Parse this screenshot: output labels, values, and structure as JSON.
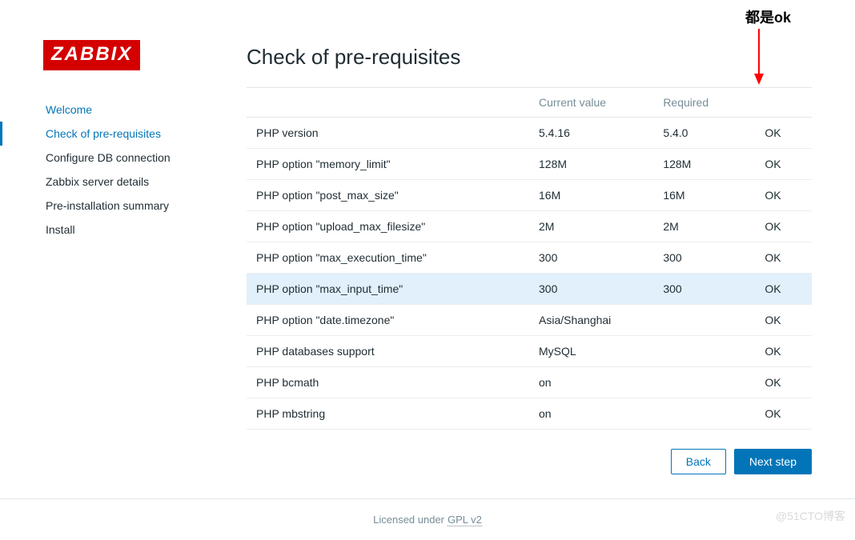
{
  "annotation": {
    "text": "都是ok"
  },
  "watermark": "@51CTO博客",
  "logo": "ZABBIX",
  "nav": {
    "items": [
      {
        "label": "Welcome",
        "state": "done"
      },
      {
        "label": "Check of pre-requisites",
        "state": "active"
      },
      {
        "label": "Configure DB connection",
        "state": ""
      },
      {
        "label": "Zabbix server details",
        "state": ""
      },
      {
        "label": "Pre-installation summary",
        "state": ""
      },
      {
        "label": "Install",
        "state": ""
      }
    ]
  },
  "page": {
    "title": "Check of pre-requisites",
    "headers": {
      "blank": "",
      "current": "Current value",
      "required": "Required",
      "status": ""
    },
    "rows": [
      {
        "name": "PHP version",
        "current": "5.4.16",
        "required": "5.4.0",
        "status": "OK",
        "hl": false
      },
      {
        "name": "PHP option \"memory_limit\"",
        "current": "128M",
        "required": "128M",
        "status": "OK",
        "hl": false
      },
      {
        "name": "PHP option \"post_max_size\"",
        "current": "16M",
        "required": "16M",
        "status": "OK",
        "hl": false
      },
      {
        "name": "PHP option \"upload_max_filesize\"",
        "current": "2M",
        "required": "2M",
        "status": "OK",
        "hl": false
      },
      {
        "name": "PHP option \"max_execution_time\"",
        "current": "300",
        "required": "300",
        "status": "OK",
        "hl": false
      },
      {
        "name": "PHP option \"max_input_time\"",
        "current": "300",
        "required": "300",
        "status": "OK",
        "hl": true
      },
      {
        "name": "PHP option \"date.timezone\"",
        "current": "Asia/Shanghai",
        "required": "",
        "status": "OK",
        "hl": false
      },
      {
        "name": "PHP databases support",
        "current": "MySQL",
        "required": "",
        "status": "OK",
        "hl": false
      },
      {
        "name": "PHP bcmath",
        "current": "on",
        "required": "",
        "status": "OK",
        "hl": false
      },
      {
        "name": "PHP mbstring",
        "current": "on",
        "required": "",
        "status": "OK",
        "hl": false
      }
    ]
  },
  "buttons": {
    "back": "Back",
    "next": "Next step"
  },
  "footer": {
    "text": "Licensed under",
    "link": "GPL v2"
  }
}
